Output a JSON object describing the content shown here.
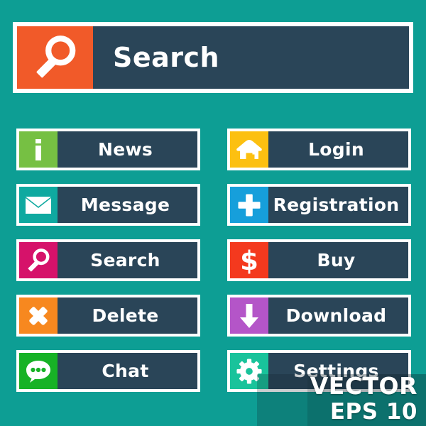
{
  "page": {
    "background_color": "#0d9e94",
    "button_body_color": "#2a4558",
    "border_color": "#ffffff",
    "text_color": "#ffffff"
  },
  "search_bar": {
    "label": "Search",
    "icon": "magnifier-icon",
    "icon_bg": "#f15a29",
    "placeholder": "Search"
  },
  "buttons": {
    "left_column": [
      {
        "label": "News",
        "icon": "info-icon",
        "icon_bg": "#76c043"
      },
      {
        "label": "Message",
        "icon": "envelope-icon",
        "icon_bg": "#0fa9a0"
      },
      {
        "label": "Search",
        "icon": "magnifier-icon",
        "icon_bg": "#d6126a"
      },
      {
        "label": "Delete",
        "icon": "cross-icon",
        "icon_bg": "#f7881f"
      },
      {
        "label": "Chat",
        "icon": "chat-bubble-icon",
        "icon_bg": "#17b226"
      }
    ],
    "right_column": [
      {
        "label": "Login",
        "icon": "home-icon",
        "icon_bg": "#fcc011"
      },
      {
        "label": "Registration",
        "icon": "plus-icon",
        "icon_bg": "#169fdb"
      },
      {
        "label": "Buy",
        "icon": "dollar-icon",
        "icon_bg": "#f4391e"
      },
      {
        "label": "Download",
        "icon": "down-arrow-icon",
        "icon_bg": "#b455c8"
      },
      {
        "label": "Settings",
        "icon": "gear-icon",
        "icon_bg": "#19c39b"
      }
    ]
  },
  "watermark": {
    "line1": "VECTOR",
    "line2": "EPS 10"
  }
}
